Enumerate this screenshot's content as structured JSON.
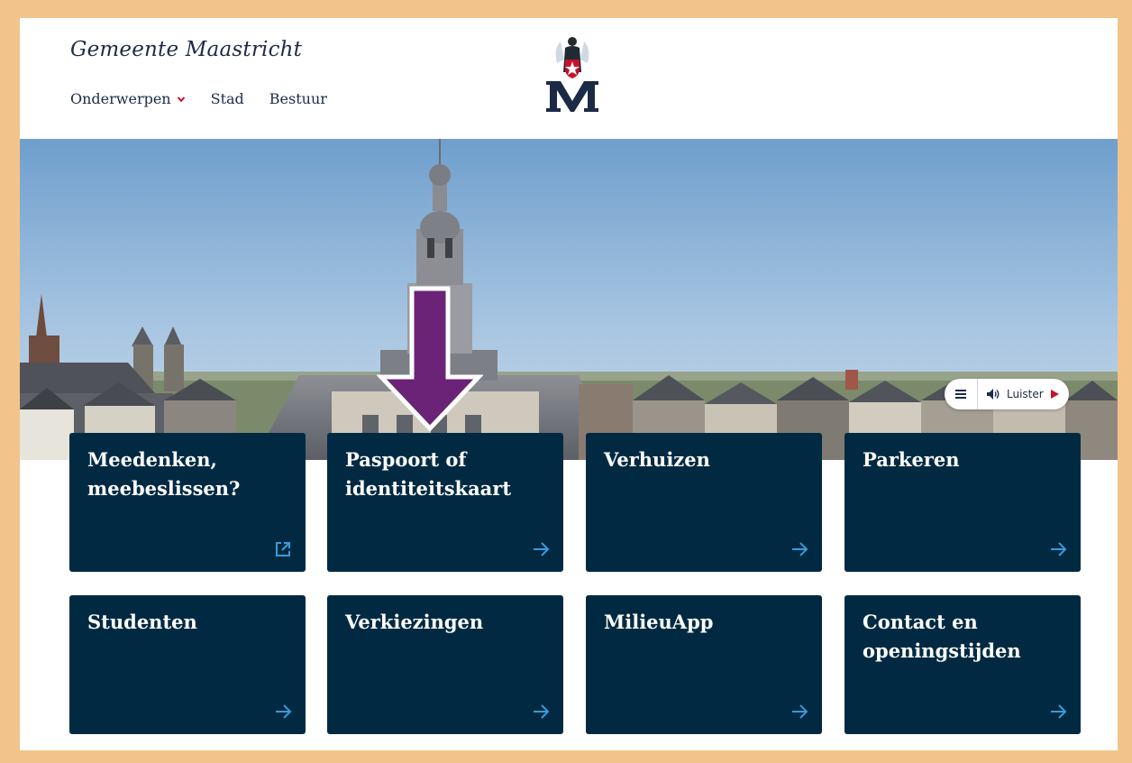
{
  "header": {
    "site_title": "Gemeente Maastricht",
    "nav": [
      {
        "label": "Onderwerpen",
        "has_dropdown": true
      },
      {
        "label": "Stad"
      },
      {
        "label": "Bestuur"
      }
    ]
  },
  "listen_widget": {
    "label": "Luister"
  },
  "tiles": [
    {
      "title": "Meedenken, meebeslissen?",
      "icon": "external-link-icon"
    },
    {
      "title": "Paspoort of identiteitskaart",
      "icon": "arrow-right-icon"
    },
    {
      "title": "Verhuizen",
      "icon": "arrow-right-icon"
    },
    {
      "title": "Parkeren",
      "icon": "arrow-right-icon"
    },
    {
      "title": "Studenten",
      "icon": "arrow-right-icon"
    },
    {
      "title": "Verkiezingen",
      "icon": "arrow-right-icon"
    },
    {
      "title": "MilieuApp",
      "icon": "arrow-right-icon"
    },
    {
      "title": "Contact en openingstijden",
      "icon": "arrow-right-icon"
    }
  ],
  "colors": {
    "tile_bg": "#012a42",
    "tile_icon": "#3a9ad9",
    "accent_red": "#c8102e",
    "annotation_arrow": "#6a2376",
    "frame_border": "#f2c48b"
  }
}
